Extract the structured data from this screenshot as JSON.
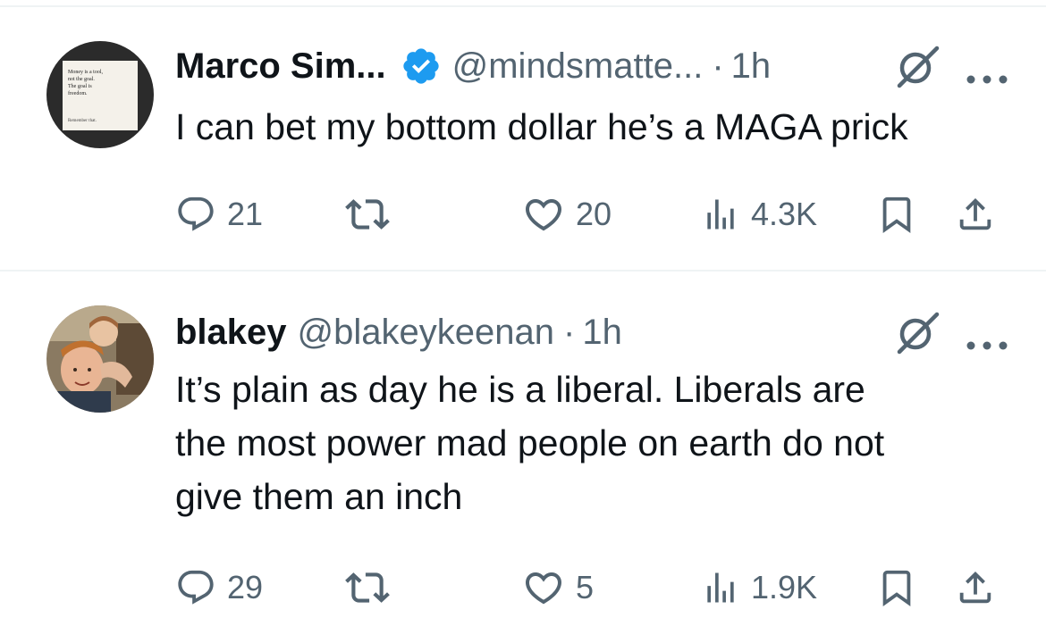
{
  "tweets": [
    {
      "display_name": "Marco Sim...",
      "verified": true,
      "handle": "@mindsmatte...",
      "separator": "·",
      "time": "1h",
      "text": "I can bet my bottom dollar he’s a MAGA prick",
      "avatar_text": [
        "Money is a tool,",
        "not the goal.",
        "The goal is",
        "freedom.",
        "Remember that."
      ],
      "replies": "21",
      "retweets": "",
      "likes": "20",
      "views": "4.3K"
    },
    {
      "display_name": "blakey",
      "verified": false,
      "handle": "@blakeykeenan",
      "separator": "·",
      "time": "1h",
      "text": "It’s plain as day he is a liberal. Liberals are\nthe most power mad people on earth do not\ngive them an inch",
      "replies": "29",
      "retweets": "",
      "likes": "5",
      "views": "1.9K"
    }
  ],
  "icons": {
    "reply": "reply-icon",
    "retweet": "retweet-icon",
    "like": "heart-icon",
    "views": "views-icon",
    "bookmark": "bookmark-icon",
    "share": "share-icon",
    "grok": "grok-icon",
    "more": "more-icon",
    "verified": "verified-badge-icon"
  },
  "colors": {
    "text": "#0f1419",
    "secondary": "#536471",
    "verified": "#1d9bf0",
    "divider": "#eff3f4"
  }
}
